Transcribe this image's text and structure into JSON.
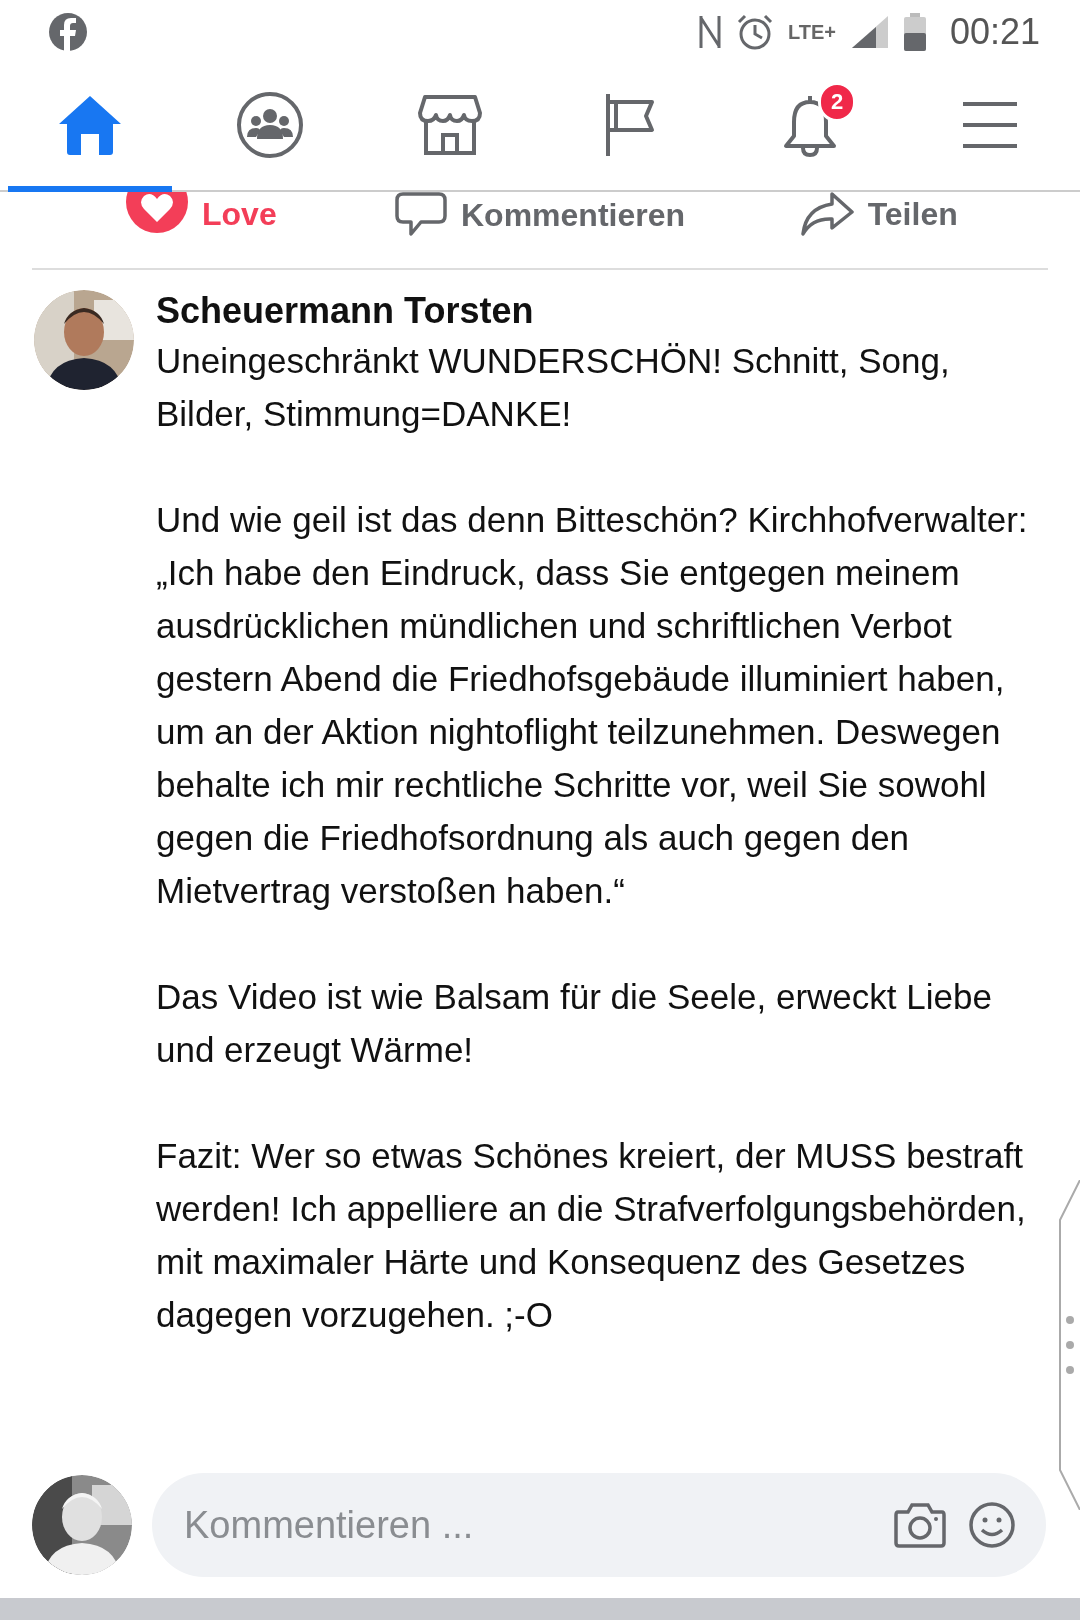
{
  "status_bar": {
    "network": "LTE+",
    "time": "00:21"
  },
  "nav_tabs": [
    {
      "kind": "home",
      "selected": true
    },
    {
      "kind": "groups",
      "selected": false
    },
    {
      "kind": "marketplace",
      "selected": false
    },
    {
      "kind": "pages",
      "selected": false
    },
    {
      "kind": "notifications",
      "selected": false,
      "badge": "2"
    },
    {
      "kind": "menu",
      "selected": false
    }
  ],
  "actions": [
    {
      "kind": "love",
      "label": "Love",
      "active": true
    },
    {
      "kind": "comment",
      "label": "Kommentieren",
      "active": false
    },
    {
      "kind": "share",
      "label": "Teilen",
      "active": false
    }
  ],
  "comment": {
    "author": "Scheuermann Torsten",
    "paragraphs": [
      "Uneingeschränkt WUNDERSCHÖN! Schnitt, Song, Bilder, Stimmung=DANKE!",
      "Und wie geil ist das denn Bitteschön? Kirchhofverwalter: „Ich habe den Eindruck, dass Sie entgegen meinem ausdrücklichen mündlichen und schriftlichen Verbot gestern Abend die Friedhofsgebäude illuminiert haben, um an der Aktion nightoflight teilzunehmen. Deswegen behalte ich mir rechtliche Schritte vor, weil Sie sowohl gegen die Friedhofsordnung als auch gegen den Mietvertrag verstoßen haben.“",
      "Das Video ist wie Balsam für die Seele, erweckt Liebe und erzeugt Wärme!",
      "Fazit: Wer so etwas Schönes kreiert, der MUSS bestraft werden! Ich appelliere an die Strafverfolgungsbehörden, mit maximaler Härte und Konsequenz des Gesetzes dagegen vorzugehen. ;-O"
    ]
  },
  "composer": {
    "placeholder": "Kommentieren ..."
  }
}
